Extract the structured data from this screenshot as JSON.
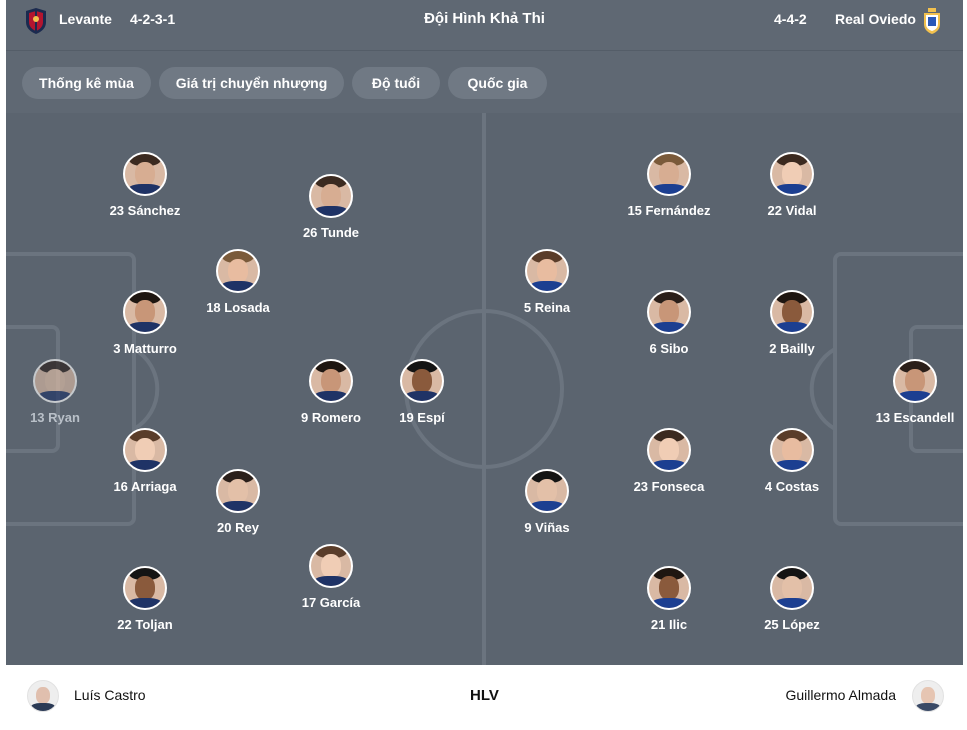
{
  "header": {
    "home_team": "Levante",
    "home_formation": "4-2-3-1",
    "title": "Đội Hình Khả Thi",
    "away_formation": "4-4-2",
    "away_team": "Real Oviedo"
  },
  "tabs": [
    "Thống kê mùa",
    "Giá trị chuyển nhượng",
    "Độ tuổi",
    "Quốc gia"
  ],
  "home_players": [
    {
      "label": "13 Ryan",
      "faded": true
    },
    {
      "label": "23 Sánchez"
    },
    {
      "label": "3 Matturro"
    },
    {
      "label": "16 Arriaga"
    },
    {
      "label": "22 Toljan"
    },
    {
      "label": "18 Losada"
    },
    {
      "label": "20 Rey"
    },
    {
      "label": "26 Tunde"
    },
    {
      "label": "9 Romero"
    },
    {
      "label": "17 García"
    },
    {
      "label": "19 Espí"
    }
  ],
  "away_players": [
    {
      "label": "13 Escandell"
    },
    {
      "label": "22 Vidal"
    },
    {
      "label": "2 Bailly"
    },
    {
      "label": "4 Costas"
    },
    {
      "label": "25 López"
    },
    {
      "label": "15 Fernández"
    },
    {
      "label": "6 Sibo"
    },
    {
      "label": "23 Fonseca"
    },
    {
      "label": "21 Ilic"
    },
    {
      "label": "5 Reina"
    },
    {
      "label": "9 Viñas"
    }
  ],
  "coaches": {
    "home_coach": "Luís Castro",
    "label": "HLV",
    "away_coach": "Guillermo Almada"
  },
  "colors": {
    "pitch": "#5b646f",
    "header": "#5f6873",
    "tab": "#707984",
    "line": "#6b747f"
  }
}
